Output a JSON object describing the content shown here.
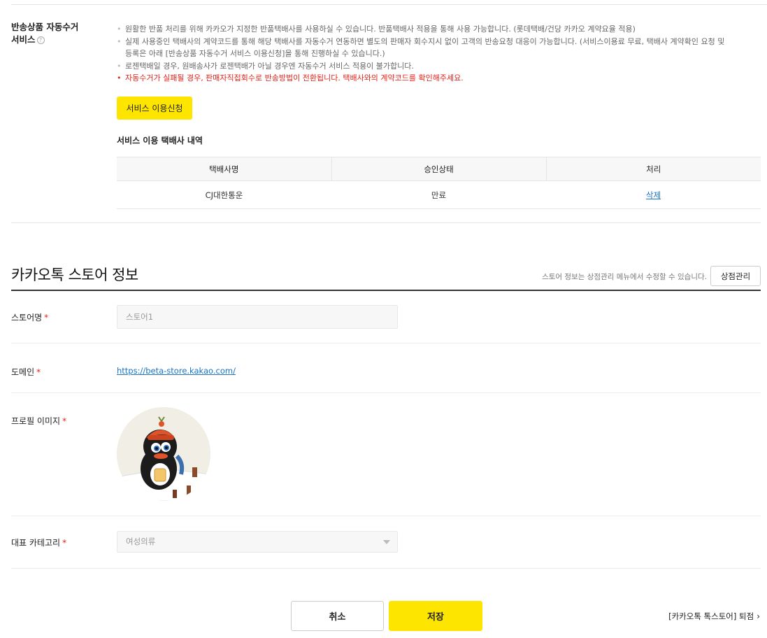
{
  "return_service": {
    "label_line1": "반송상품 자동수거",
    "label_line2": "서비스",
    "notes": [
      "원활한 반품 처리를 위해 카카오가 지정한 반품택배사를 사용하실 수 있습니다. 반품택배사 적용을 통해 사용 가능합니다. (롯데택배/건당 카카오 계약요율 적용)",
      "실제 사용중인 택배사의 계약코드를 통해 해당 택배사를 자동수거 연동하면 별도의 판매자 회수지시 없이 고객의 반송요청 대응이 가능합니다. (서비스이용료 무료, 택배사 계약확인 요청 및",
      "등록은 아래 [반송상품 자동수거 서비스 이용신청]을 통해 진행하실 수 있습니다.)",
      "로젠택배일 경우, 원배송사가 로젠택배가 아닐 경우엔 자동수거 서비스 적용이 불가합니다."
    ],
    "warning": "자동수거가 실패될 경우, 판매자직접회수로 반송방법이 전환됩니다. 택배사와의 계약코드를 확인해주세요.",
    "apply_button": "서비스 이용신청",
    "courier_title": "서비스 이용 택배사 내역",
    "table": {
      "headers": [
        "택배사명",
        "승인상태",
        "처리"
      ],
      "rows": [
        {
          "courier": "CJ대한통운",
          "status": "만료",
          "action": "삭제"
        }
      ]
    }
  },
  "store_info": {
    "title": "카카오톡 스토어 정보",
    "note": "스토어 정보는 상점관리 메뉴에서 수정할 수 있습니다.",
    "manage_button": "상점관리",
    "required_mark": "*",
    "fields": {
      "store_name": {
        "label": "스토어명",
        "value": "스토어1"
      },
      "domain": {
        "label": "도메인",
        "value": "https://beta-store.kakao.com/"
      },
      "profile_image": {
        "label": "프로필 이미지"
      },
      "category": {
        "label": "대표 카테고리",
        "value": "여성의류"
      }
    }
  },
  "footer": {
    "cancel": "취소",
    "save": "저장",
    "withdraw": "[카카오톡 톡스토어] 퇴점",
    "withdraw_chevron": "›"
  },
  "colors": {
    "accent_yellow": "#fee500",
    "link_blue": "#1a73c7",
    "warning_red": "#e2231a"
  }
}
